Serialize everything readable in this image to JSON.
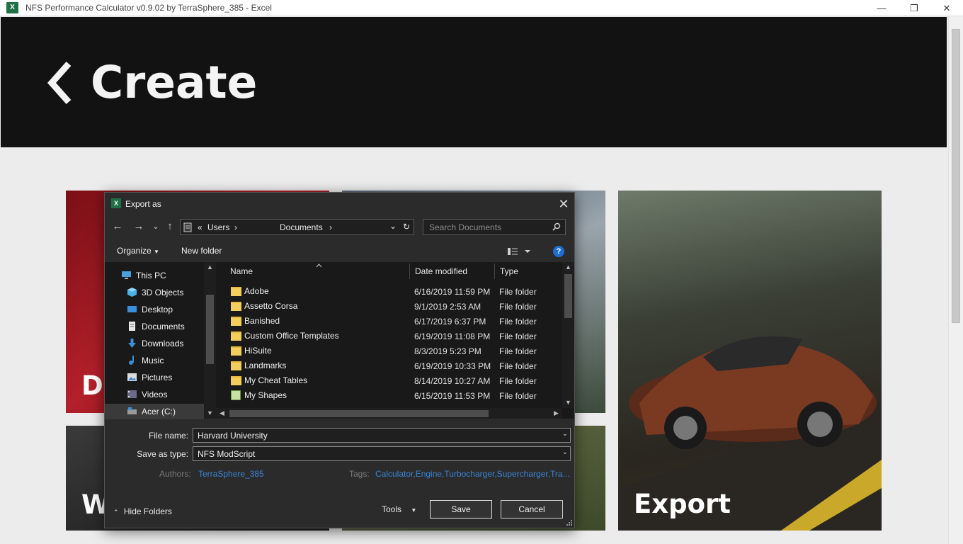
{
  "window": {
    "title": "NFS Performance Calculator v0.9.02 by TerraSphere_385 - Excel",
    "app_logo": "X",
    "controls": {
      "minimize": "—",
      "maximize": "❐",
      "close": "✕"
    }
  },
  "banner": {
    "back_icon": "chevron-left-icon",
    "title": "Create"
  },
  "tiles": [
    {
      "label": "D",
      "color": "#8e1a1f"
    },
    {
      "label": "W",
      "color": "#222222"
    },
    {
      "label": "Export",
      "color": "#3a3a32"
    }
  ],
  "dialog": {
    "title": "Export as",
    "app_logo": "X",
    "close": "✕",
    "nav": {
      "back": "←",
      "forward": "→",
      "recent": "⌄",
      "up": "↑"
    },
    "address": {
      "sep_left": "«",
      "crumbs": [
        "Users",
        "Documents"
      ],
      "sep": "›",
      "refresh": "↻",
      "dropdown": "⌄"
    },
    "search_placeholder": "Search Documents",
    "toolbar": {
      "organize": "Organize",
      "new_folder": "New folder",
      "help": "?"
    },
    "tree": [
      {
        "label": "This PC",
        "icon": "pc-icon"
      },
      {
        "label": "3D Objects",
        "icon": "cube-icon"
      },
      {
        "label": "Desktop",
        "icon": "desktop-icon"
      },
      {
        "label": "Documents",
        "icon": "documents-icon"
      },
      {
        "label": "Downloads",
        "icon": "download-icon"
      },
      {
        "label": "Music",
        "icon": "music-icon"
      },
      {
        "label": "Pictures",
        "icon": "pictures-icon"
      },
      {
        "label": "Videos",
        "icon": "videos-icon"
      },
      {
        "label": "Acer (C:)",
        "icon": "drive-icon"
      }
    ],
    "columns": {
      "name": "Name",
      "date": "Date modified",
      "type": "Type"
    },
    "files": [
      {
        "name": "Adobe",
        "date": "6/16/2019 11:59 PM",
        "type": "File folder",
        "icon": "folder"
      },
      {
        "name": "Assetto Corsa",
        "date": "9/1/2019 2:53 AM",
        "type": "File folder",
        "icon": "folder"
      },
      {
        "name": "Banished",
        "date": "6/17/2019 6:37 PM",
        "type": "File folder",
        "icon": "folder"
      },
      {
        "name": "Custom Office Templates",
        "date": "6/19/2019 11:08 PM",
        "type": "File folder",
        "icon": "folder"
      },
      {
        "name": "HiSuite",
        "date": "8/3/2019 5:23 PM",
        "type": "File folder",
        "icon": "folder"
      },
      {
        "name": "Landmarks",
        "date": "6/19/2019 10:33 PM",
        "type": "File folder",
        "icon": "folder"
      },
      {
        "name": "My Cheat Tables",
        "date": "8/14/2019 10:27 AM",
        "type": "File folder",
        "icon": "folder"
      },
      {
        "name": "My Shapes",
        "date": "6/15/2019 11:53 PM",
        "type": "File folder",
        "icon": "shapes"
      }
    ],
    "file_name_label": "File name:",
    "file_name_value": "Harvard University",
    "save_type_label": "Save as type:",
    "save_type_value": "NFS ModScript",
    "authors_label": "Authors:",
    "authors_value": "TerraSphere_385",
    "tags_label": "Tags:",
    "tags_value": "Calculator,Engine,Turbocharger,Supercharger,Tra...",
    "hide_folders": "Hide Folders",
    "tools": "Tools",
    "save": "Save",
    "cancel": "Cancel"
  }
}
